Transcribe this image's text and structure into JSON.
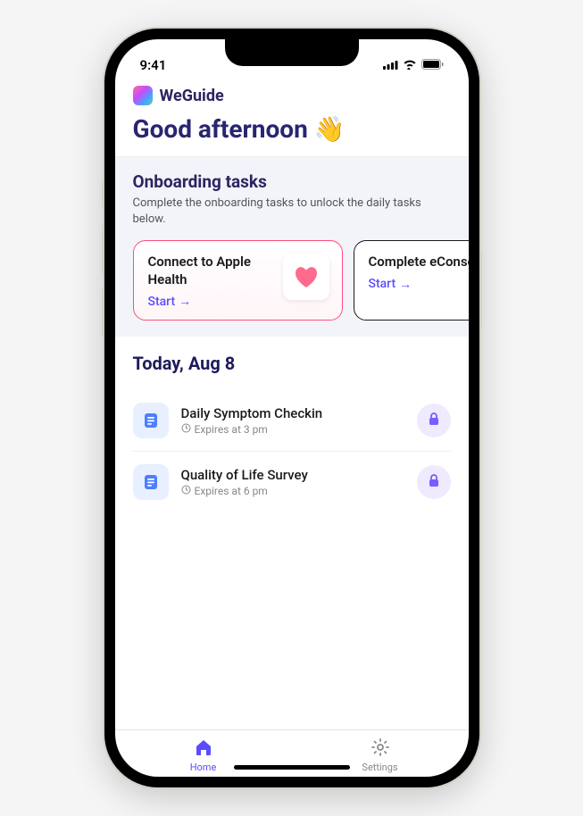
{
  "statusBar": {
    "time": "9:41"
  },
  "app": {
    "name": "WeGuide"
  },
  "greeting": "Good afternoon 👋",
  "onboarding": {
    "title": "Onboarding tasks",
    "description": "Complete the onboarding tasks to unlock the daily tasks below.",
    "cards": [
      {
        "title": "Connect to Apple Health",
        "action": "Start"
      },
      {
        "title": "Complete eConsent",
        "action": "Start"
      }
    ]
  },
  "today": {
    "title": "Today, Aug 8",
    "tasks": [
      {
        "name": "Daily Symptom Checkin",
        "expires": "Expires at 3 pm"
      },
      {
        "name": "Quality of Life Survey",
        "expires": "Expires at 6 pm"
      }
    ]
  },
  "tabs": {
    "home": "Home",
    "settings": "Settings"
  }
}
